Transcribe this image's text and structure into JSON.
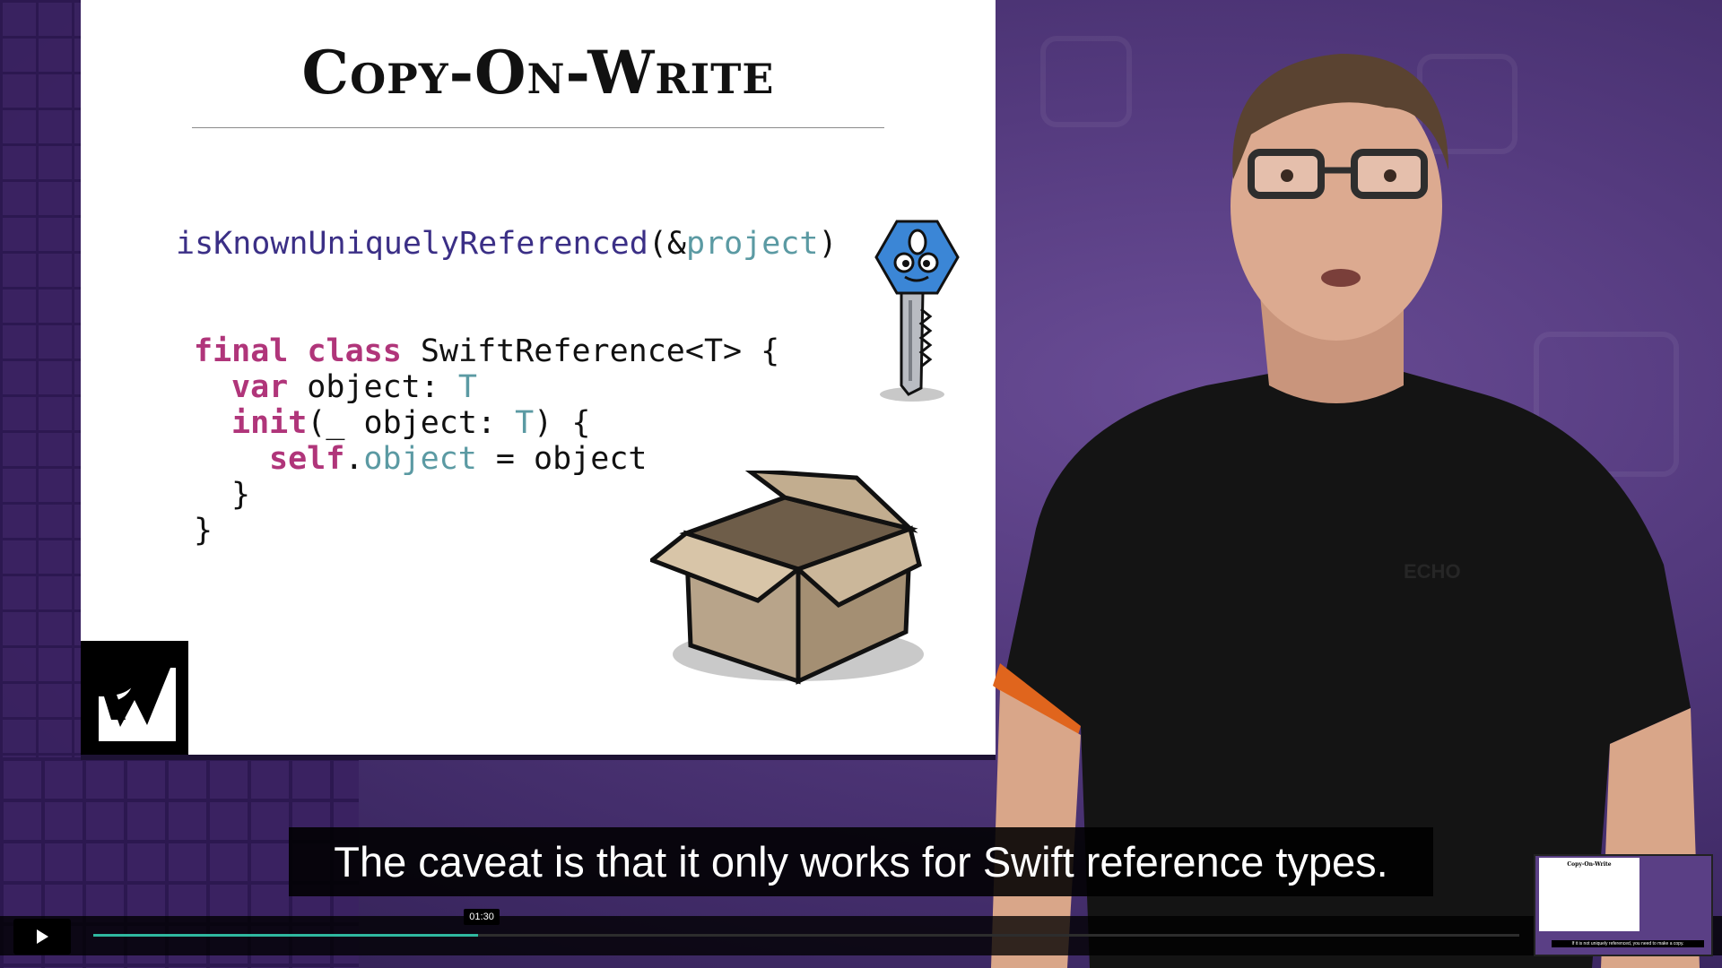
{
  "slide": {
    "title": "Copy-On-Write",
    "code": {
      "known_fn": "isKnownUniquelyReferenced",
      "known_open": "(&",
      "known_arg": "project",
      "known_close": ")",
      "l1_kw1": "final",
      "l1_kw2": "class",
      "l1_rest": " SwiftReference<T> {",
      "l2_kw": "var",
      "l2_rest": " object: ",
      "l2_type": "T",
      "l3_kw": "init",
      "l3_rest": "(_ object: ",
      "l3_type": "T",
      "l3_end": ") {",
      "l4_kw": "self",
      "l4_dot": ".",
      "l4_prop": "object",
      "l4_rest": " = object",
      "l5": "}",
      "l6": "}"
    }
  },
  "caption": {
    "text": "The caveat is that it only works for Swift reference types."
  },
  "player": {
    "play_icon": "play-icon",
    "current_time": "01:30",
    "progress_fraction": 0.27,
    "accent_color": "#2fb8a0"
  },
  "thumbnail": {
    "title": "Copy-On-Write",
    "caption": "If it is not uniquely referenced, you need to make a copy."
  }
}
